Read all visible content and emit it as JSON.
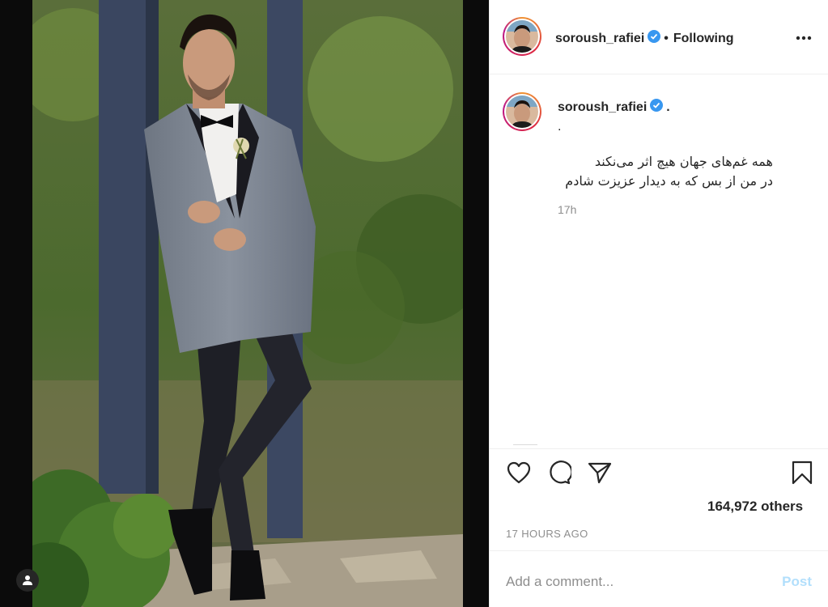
{
  "post": {
    "author": "soroush_rafiei",
    "follow_status": "Following",
    "separator": "•"
  },
  "caption": {
    "author": "soroush_rafiei",
    "dot_inline": ".",
    "dot_line": ".",
    "line1": "همه غم‌های جهان هیچ اثر می‌نکند",
    "line2": "در من از بس که به دیدار عزیزت شادم",
    "time": "17h"
  },
  "stats": {
    "likes": "164,972 others",
    "timestamp": "17 HOURS AGO"
  },
  "comment": {
    "placeholder": "Add a comment...",
    "post_label": "Post"
  },
  "colors": {
    "verified": "#3897f0",
    "post_disabled": "#b2dffc",
    "muted": "#8e8e8e",
    "text": "#262626"
  },
  "icons": [
    "user-tag-icon",
    "verified-icon",
    "more-options-icon",
    "heart-icon",
    "comment-icon",
    "share-icon",
    "bookmark-icon"
  ]
}
